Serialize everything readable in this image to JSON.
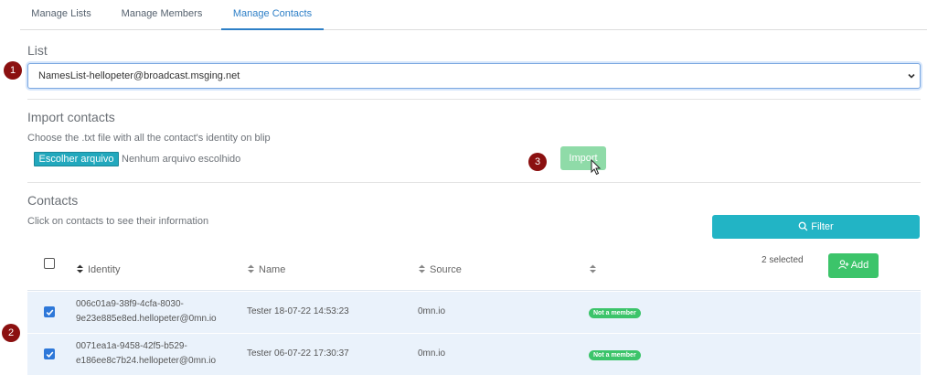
{
  "tabs": [
    {
      "label": "Manage Lists",
      "active": false
    },
    {
      "label": "Manage Members",
      "active": false
    },
    {
      "label": "Manage Contacts",
      "active": true
    }
  ],
  "list_section": {
    "title": "List",
    "selected_value": "NamesList-hellopeter@broadcast.msging.net"
  },
  "import_section": {
    "title": "Import contacts",
    "helper": "Choose the .txt file with all the contact's identity on blip",
    "file_button": "Escolher arquivo",
    "file_status": "Nenhum arquivo escolhido",
    "import_button": "Import"
  },
  "contacts_section": {
    "title": "Contacts",
    "helper": "Click on contacts to see their information",
    "filter_button": "Filter",
    "selected_text": "2 selected",
    "add_button": "Add",
    "columns": [
      "Identity",
      "Name",
      "Source",
      ""
    ],
    "rows": [
      {
        "checked": true,
        "identity_line1": "006c01a9-38f9-4cfa-8030-",
        "identity_line2": "9e23e885e8ed.hellopeter@0mn.io",
        "name": "Tester 18-07-22 14:53:23",
        "source": "0mn.io",
        "status": "Not a member"
      },
      {
        "checked": true,
        "identity_line1": "0071ea1a-9458-42f5-b529-",
        "identity_line2": "e186ee8c7b24.hellopeter@0mn.io",
        "name": "Tester 06-07-22 17:30:37",
        "source": "0mn.io",
        "status": "Not a member"
      }
    ]
  },
  "steps": [
    "1",
    "2",
    "3"
  ],
  "colors": {
    "accent": "#2d7fc7",
    "teal": "#22b4c5",
    "green": "#3cc46a",
    "step": "#8b1010",
    "row_bg": "#eaf2fb"
  }
}
